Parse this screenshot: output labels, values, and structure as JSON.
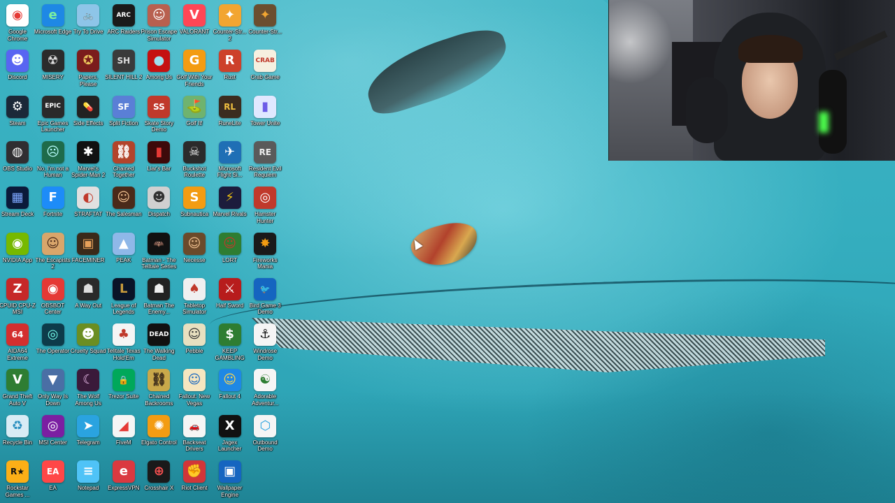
{
  "desktop": {
    "icons": [
      {
        "label": "Google Chrome",
        "icon": "chrome-icon",
        "color": "#ffffff",
        "glyph": "◉",
        "fg": "#e53935"
      },
      {
        "label": "Microsoft Edge",
        "icon": "edge-icon",
        "color": "#1e88e5",
        "glyph": "e",
        "fg": "#7cf0a0"
      },
      {
        "label": "Try To Drive",
        "icon": "try-to-drive-icon",
        "color": "#8ec5e8",
        "glyph": "🚲",
        "fg": "#fff"
      },
      {
        "label": "ARC Raiders",
        "icon": "arc-raiders-icon",
        "color": "#1a1a1a",
        "glyph": "ARC",
        "fg": "#fff"
      },
      {
        "label": "Prison Escape Simulator",
        "icon": "prison-escape-icon",
        "color": "#b8604f",
        "glyph": "☺",
        "fg": "#fff"
      },
      {
        "label": "VALORANT",
        "icon": "valorant-icon",
        "color": "#ff4655",
        "glyph": "V",
        "fg": "#fff"
      },
      {
        "label": "Counter-Str... 2",
        "icon": "counter-strike-2-icon",
        "color": "#f2a531",
        "glyph": "✦",
        "fg": "#fff"
      },
      {
        "label": "Counter-Str...",
        "icon": "counter-strike-icon",
        "color": "#6b4e2f",
        "glyph": "✦",
        "fg": "#f2a531"
      },
      {
        "label": "Discord",
        "icon": "discord-icon",
        "color": "#5865f2",
        "glyph": "☻",
        "fg": "#fff"
      },
      {
        "label": "MISERY",
        "icon": "misery-icon",
        "color": "#2b2b2b",
        "glyph": "☢",
        "fg": "#ddd"
      },
      {
        "label": "Papers, Please",
        "icon": "papers-please-icon",
        "color": "#7b1c1c",
        "glyph": "✪",
        "fg": "#e8c25a"
      },
      {
        "label": "SILENT HILL 2",
        "icon": "silent-hill-2-icon",
        "color": "#3a3a3a",
        "glyph": "SH",
        "fg": "#ddd"
      },
      {
        "label": "Among Us",
        "icon": "among-us-icon",
        "color": "#c51111",
        "glyph": "●",
        "fg": "#9ee0ef"
      },
      {
        "label": "Golf With Your Friends",
        "icon": "golf-with-friends-icon",
        "color": "#f39c12",
        "glyph": "G",
        "fg": "#fff"
      },
      {
        "label": "Rust",
        "icon": "rust-icon",
        "color": "#cd412b",
        "glyph": "R",
        "fg": "#fff"
      },
      {
        "label": "Crab Game",
        "icon": "crab-game-icon",
        "color": "#f6f0e0",
        "glyph": "CRAB",
        "fg": "#c0392b"
      },
      {
        "label": "Steam",
        "icon": "steam-icon",
        "color": "#1b2838",
        "glyph": "⚙",
        "fg": "#fff"
      },
      {
        "label": "Epic Games Launcher",
        "icon": "epic-games-icon",
        "color": "#2a2a2a",
        "glyph": "EPIC",
        "fg": "#fff"
      },
      {
        "label": "Side Effects",
        "icon": "side-effects-icon",
        "color": "#222",
        "glyph": "💊",
        "fg": "#ffd54f"
      },
      {
        "label": "Split Fiction",
        "icon": "split-fiction-icon",
        "color": "#5a7fd6",
        "glyph": "SF",
        "fg": "#fff"
      },
      {
        "label": "Skate Story Demo",
        "icon": "skate-story-icon",
        "color": "#c0392b",
        "glyph": "SS",
        "fg": "#fff"
      },
      {
        "label": "Golf It!",
        "icon": "golf-it-icon",
        "color": "#6fb36f",
        "glyph": "⛳",
        "fg": "#fff"
      },
      {
        "label": "RuneLite",
        "icon": "runelite-icon",
        "color": "#3b2c1f",
        "glyph": "RL",
        "fg": "#f0c040"
      },
      {
        "label": "Tower Unite",
        "icon": "tower-unite-icon",
        "color": "#e0e8ff",
        "glyph": "▮",
        "fg": "#6c5ce7"
      },
      {
        "label": "OBS Studio",
        "icon": "obs-icon",
        "color": "#302e31",
        "glyph": "◍",
        "fg": "#fff"
      },
      {
        "label": "No, I'm not a Human",
        "icon": "not-a-human-icon",
        "color": "#1e6b4a",
        "glyph": "☹",
        "fg": "#bff"
      },
      {
        "label": "Marvel's Spider-Man 2",
        "icon": "spider-man-2-icon",
        "color": "#111",
        "glyph": "✱",
        "fg": "#fff"
      },
      {
        "label": "Chained Together",
        "icon": "chained-together-icon",
        "color": "#b2442b",
        "glyph": "⛓",
        "fg": "#fff"
      },
      {
        "label": "Liar's Bar",
        "icon": "liars-bar-icon",
        "color": "#3d0a0a",
        "glyph": "▮",
        "fg": "#e53935"
      },
      {
        "label": "Buckshot Roulette",
        "icon": "buckshot-roulette-icon",
        "color": "#2b2b2b",
        "glyph": "☠",
        "fg": "#eee"
      },
      {
        "label": "Microsoft Flight Si...",
        "icon": "flight-simulator-icon",
        "color": "#1f6fb5",
        "glyph": "✈",
        "fg": "#fff"
      },
      {
        "label": "Resident Evil Requiem",
        "icon": "resident-evil-icon",
        "color": "#5a5a5a",
        "glyph": "RE",
        "fg": "#eee"
      },
      {
        "label": "Stream Deck",
        "icon": "stream-deck-icon",
        "color": "#0b1a3a",
        "glyph": "▦",
        "fg": "#7ea7ff"
      },
      {
        "label": "Fortnite",
        "icon": "fortnite-icon",
        "color": "#1d8cf8",
        "glyph": "F",
        "fg": "#fff"
      },
      {
        "label": "STRAFTAT",
        "icon": "straftat-icon",
        "color": "#e0e0e0",
        "glyph": "◐",
        "fg": "#c0392b"
      },
      {
        "label": "The Salesman",
        "icon": "the-salesman-icon",
        "color": "#4a2a1a",
        "glyph": "☺",
        "fg": "#f0c090"
      },
      {
        "label": "Dispatch",
        "icon": "dispatch-icon",
        "color": "#d0d0d0",
        "glyph": "☻",
        "fg": "#333"
      },
      {
        "label": "Subnautica",
        "icon": "subnautica-icon",
        "color": "#f39c12",
        "glyph": "S",
        "fg": "#fff"
      },
      {
        "label": "Marvel Rivals",
        "icon": "marvel-rivals-icon",
        "color": "#1c1c3c",
        "glyph": "⚡",
        "fg": "#f1c40f"
      },
      {
        "label": "Hamster Hunter",
        "icon": "hamster-hunter-icon",
        "color": "#c0392b",
        "glyph": "◎",
        "fg": "#fff"
      },
      {
        "label": "NVIDIA App",
        "icon": "nvidia-icon",
        "color": "#76b900",
        "glyph": "◉",
        "fg": "#fff"
      },
      {
        "label": "The Escapists 2",
        "icon": "escapists-2-icon",
        "color": "#d9a66b",
        "glyph": "☺",
        "fg": "#4a2a1a"
      },
      {
        "label": "FACEMINER",
        "icon": "faceminer-icon",
        "color": "#3a2a1a",
        "glyph": "▣",
        "fg": "#e6a05a"
      },
      {
        "label": "PEAK",
        "icon": "peak-icon",
        "color": "#8fb8e8",
        "glyph": "▲",
        "fg": "#fff"
      },
      {
        "label": "Batman - The Telltale Series",
        "icon": "batman-telltale-icon",
        "color": "#111",
        "glyph": "🦇",
        "fg": "#fff"
      },
      {
        "label": "Necesse",
        "icon": "necesse-icon",
        "color": "#6b4a2b",
        "glyph": "☺",
        "fg": "#f0c090"
      },
      {
        "label": "LORT",
        "icon": "lort-icon",
        "color": "#2e7d32",
        "glyph": "☺",
        "fg": "#c0392b"
      },
      {
        "label": "Fireworks Mania",
        "icon": "fireworks-mania-icon",
        "color": "#1a1a1a",
        "glyph": "✸",
        "fg": "#f39c12"
      },
      {
        "label": "CPUID CPU-Z MSI",
        "icon": "cpu-z-icon",
        "color": "#c62828",
        "glyph": "Z",
        "fg": "#fff"
      },
      {
        "label": "OBSBOT Center",
        "icon": "obsbot-icon",
        "color": "#e53935",
        "glyph": "◉",
        "fg": "#fff"
      },
      {
        "label": "A Way Out",
        "icon": "a-way-out-icon",
        "color": "#2a2a2a",
        "glyph": "☗",
        "fg": "#ddd"
      },
      {
        "label": "League of Legends",
        "icon": "league-of-legends-icon",
        "color": "#0a1428",
        "glyph": "L",
        "fg": "#c89b3c"
      },
      {
        "label": "Batman The Enemy...",
        "icon": "batman-enemy-within-icon",
        "color": "#222",
        "glyph": "☗",
        "fg": "#eee"
      },
      {
        "label": "Tabletop Simulator",
        "icon": "tabletop-simulator-icon",
        "color": "#f0f0f0",
        "glyph": "♠",
        "fg": "#c0392b"
      },
      {
        "label": "Half Sword",
        "icon": "half-sword-icon",
        "color": "#b71c1c",
        "glyph": "⚔",
        "fg": "#fff"
      },
      {
        "label": "Bird Game 3 Demo",
        "icon": "bird-game-3-icon",
        "color": "#1565c0",
        "glyph": "🐦",
        "fg": "#fff"
      },
      {
        "label": "AIDA64 Extreme",
        "icon": "aida64-icon",
        "color": "#d32f2f",
        "glyph": "64",
        "fg": "#fff"
      },
      {
        "label": "The Operator",
        "icon": "the-operator-icon",
        "color": "#0d3b4a",
        "glyph": "◎",
        "fg": "#7fe"
      },
      {
        "label": "Cruelty Squad",
        "icon": "cruelty-squad-icon",
        "color": "#6b8e23",
        "glyph": "☻",
        "fg": "#fff"
      },
      {
        "label": "Telltale Texas Hold'Em",
        "icon": "telltale-texas-holdem-icon",
        "color": "#f5f5f5",
        "glyph": "♣",
        "fg": "#c0392b"
      },
      {
        "label": "The Walking Dead",
        "icon": "walking-dead-icon",
        "color": "#111",
        "glyph": "DEAD",
        "fg": "#fff"
      },
      {
        "label": "Pebble",
        "icon": "pebble-icon",
        "color": "#e8e0c0",
        "glyph": "☺",
        "fg": "#333"
      },
      {
        "label": "KEEP GAMBLING",
        "icon": "keep-gambling-icon",
        "color": "#2e7d32",
        "glyph": "$",
        "fg": "#fff"
      },
      {
        "label": "Windrose Demo",
        "icon": "windrose-icon",
        "color": "#f5f5f5",
        "glyph": "⚓",
        "fg": "#111"
      },
      {
        "label": "Grand Theft Auto V",
        "icon": "gta-v-icon",
        "color": "#2e7d32",
        "glyph": "V",
        "fg": "#fff"
      },
      {
        "label": "Only Way Is Down",
        "icon": "only-way-is-down-icon",
        "color": "#4a6fa5",
        "glyph": "▼",
        "fg": "#fff"
      },
      {
        "label": "The Wolf Among Us",
        "icon": "wolf-among-us-icon",
        "color": "#3a1a3a",
        "glyph": "☾",
        "fg": "#f0c0f0"
      },
      {
        "label": "Trezor Suite",
        "icon": "trezor-suite-icon",
        "color": "#00a85a",
        "glyph": "🔒",
        "fg": "#fff"
      },
      {
        "label": "Chained Backrooms",
        "icon": "chained-backrooms-icon",
        "color": "#c9a84a",
        "glyph": "⛓",
        "fg": "#3a2a1a"
      },
      {
        "label": "Fallout: New Vegas",
        "icon": "fallout-new-vegas-icon",
        "color": "#f5e6c0",
        "glyph": "☺",
        "fg": "#1565c0"
      },
      {
        "label": "Fallout 4",
        "icon": "fallout-4-icon",
        "color": "#1e88e5",
        "glyph": "☺",
        "fg": "#ffd54f"
      },
      {
        "label": "Adorable Adventur...",
        "icon": "adorable-adventure-icon",
        "color": "#f5f5f5",
        "glyph": "☯",
        "fg": "#2e7d32"
      },
      {
        "label": "Recycle Bin",
        "icon": "recycle-bin-icon",
        "color": "#d8ecf5",
        "glyph": "♻",
        "fg": "#2a8fbf"
      },
      {
        "label": "MSI Center",
        "icon": "msi-center-icon",
        "color": "#7b1fa2",
        "glyph": "◎",
        "fg": "#fff"
      },
      {
        "label": "Telegram",
        "icon": "telegram-icon",
        "color": "#2aa3e0",
        "glyph": "➤",
        "fg": "#fff"
      },
      {
        "label": "FiveM",
        "icon": "fivem-icon",
        "color": "#f5f5f5",
        "glyph": "◢",
        "fg": "#e53935"
      },
      {
        "label": "Elgato Control",
        "icon": "elgato-control-icon",
        "color": "#f39c12",
        "glyph": "✺",
        "fg": "#fff"
      },
      {
        "label": "Backseat Drivers",
        "icon": "backseat-drivers-icon",
        "color": "#f5f5f5",
        "glyph": "🚗",
        "fg": "#c0392b"
      },
      {
        "label": "Jagex Launcher",
        "icon": "jagex-launcher-icon",
        "color": "#111",
        "glyph": "X",
        "fg": "#fff"
      },
      {
        "label": "Outbound Demo",
        "icon": "outbound-demo-icon",
        "color": "#f5f5f5",
        "glyph": "⬡",
        "fg": "#2aa3e0"
      },
      {
        "label": "Rockstar Games ...",
        "icon": "rockstar-games-icon",
        "color": "#fcaf17",
        "glyph": "R★",
        "fg": "#111"
      },
      {
        "label": "EA",
        "icon": "ea-icon",
        "color": "#ff4747",
        "glyph": "EA",
        "fg": "#fff"
      },
      {
        "label": "Notepad",
        "icon": "notepad-icon",
        "color": "#4fc3f7",
        "glyph": "≡",
        "fg": "#fff"
      },
      {
        "label": "ExpressVPN",
        "icon": "expressvpn-icon",
        "color": "#da3940",
        "glyph": "e",
        "fg": "#fff"
      },
      {
        "label": "Crosshair X",
        "icon": "crosshair-x-icon",
        "color": "#1a1a1a",
        "glyph": "⊕",
        "fg": "#ff5252"
      },
      {
        "label": "Riot Client",
        "icon": "riot-client-icon",
        "color": "#d13639",
        "glyph": "✊",
        "fg": "#fff"
      },
      {
        "label": "Wallpaper Engine",
        "icon": "wallpaper-engine-icon",
        "color": "#1565c0",
        "glyph": "▣",
        "fg": "#fff"
      }
    ]
  },
  "webcam": {
    "icon": "webcam-overlay"
  },
  "wallpaper": {
    "accent": "#2fa7b7"
  }
}
